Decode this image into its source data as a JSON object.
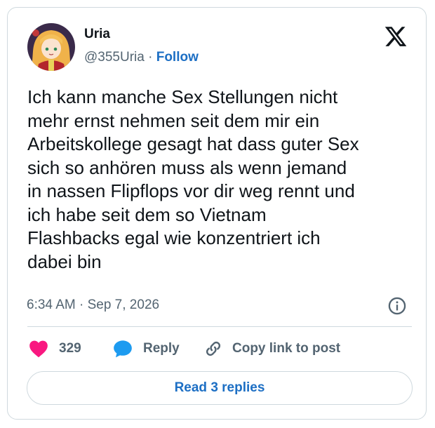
{
  "author": {
    "name": "Uria",
    "handle": "@355Uria",
    "separator": "·",
    "follow_label": "Follow",
    "avatar_icon": "anime-avatar-icon"
  },
  "platform_icon": "x-logo-icon",
  "tweet": {
    "text": "Ich kann manche Sex Stellungen nicht\nmehr ernst nehmen seit dem mir ein\nArbeitskollege gesagt hat dass guter Sex\nsich so anhören muss als wenn jemand\nin nassen Flipflops vor dir weg rennt und\nich habe seit dem so Vietnam\nFlashbacks egal wie konzentriert ich\ndabei bin",
    "timestamp": "6:34 AM · Sep 7, 2026"
  },
  "actions": {
    "like_count": "329",
    "reply_label": "Reply",
    "copy_link_label": "Copy link to post"
  },
  "read_replies_label": "Read 3 replies",
  "colors": {
    "text_primary": "#0f1419",
    "text_secondary": "#536471",
    "link_blue": "#1d6fc4",
    "like_pink": "#f91880",
    "reply_blue": "#1d9bf0",
    "border": "#cfd9de"
  }
}
